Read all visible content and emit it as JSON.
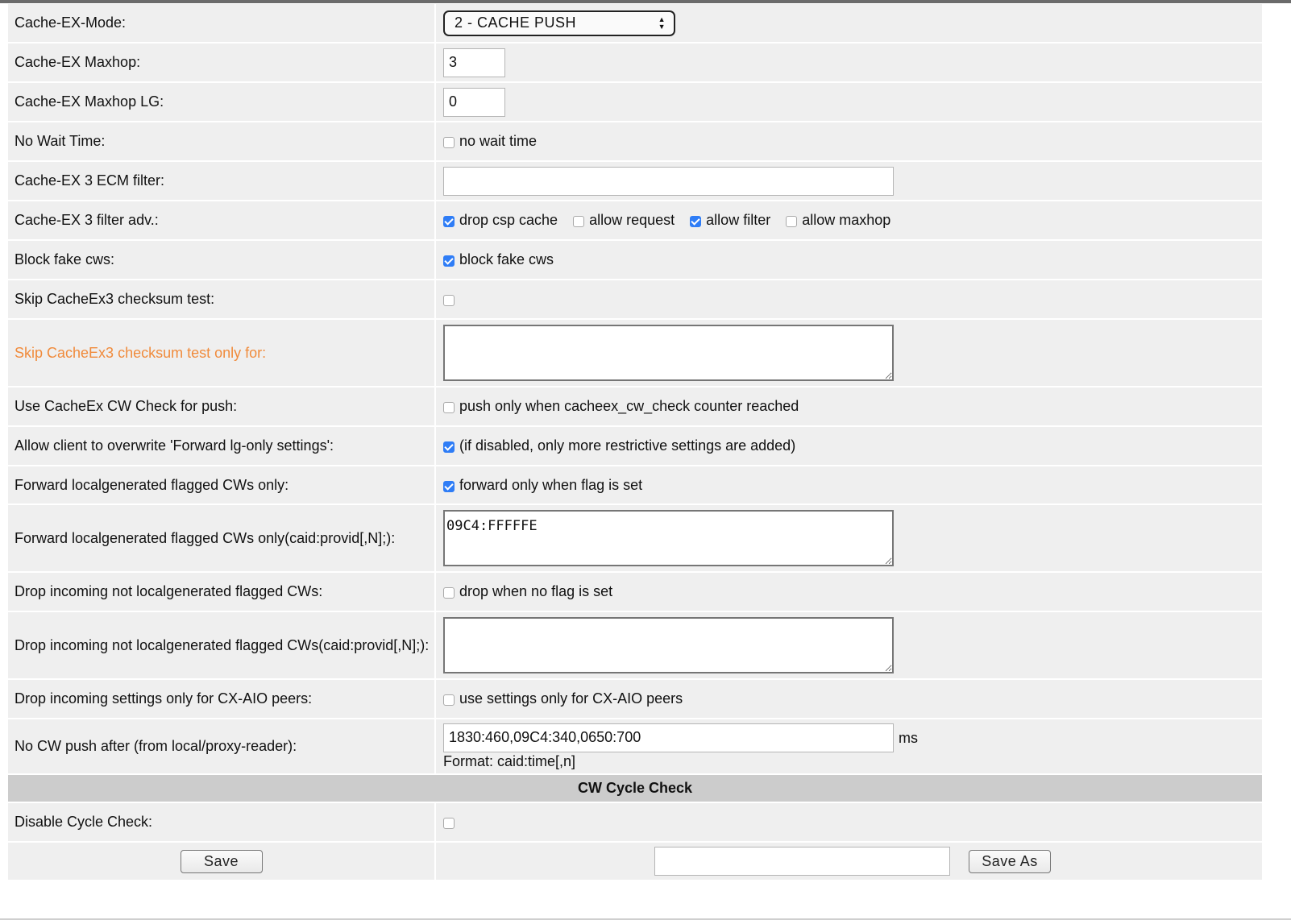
{
  "rows": {
    "cacheex_mode": {
      "label": "Cache-EX-Mode:",
      "value": "2 - CACHE PUSH"
    },
    "maxhop": {
      "label": "Cache-EX Maxhop:",
      "value": "3"
    },
    "maxhop_lg": {
      "label": "Cache-EX Maxhop LG:",
      "value": "0"
    },
    "no_wait": {
      "label": "No Wait Time:",
      "checkbox_label": "no wait time",
      "checked": false
    },
    "ecm_filter": {
      "label": "Cache-EX 3 ECM filter:",
      "value": ""
    },
    "filter_adv": {
      "label": "Cache-EX 3 filter adv.:",
      "options": [
        {
          "label": "drop csp cache",
          "checked": true
        },
        {
          "label": "allow request",
          "checked": false
        },
        {
          "label": "allow filter",
          "checked": true
        },
        {
          "label": "allow maxhop",
          "checked": false
        }
      ]
    },
    "block_fake": {
      "label": "Block fake cws:",
      "checkbox_label": "block fake cws",
      "checked": true
    },
    "skip_checksum": {
      "label": "Skip CacheEx3 checksum test:",
      "checked": false
    },
    "skip_checksum_only": {
      "label": "Skip CacheEx3 checksum test only for:",
      "value": ""
    },
    "cw_check_push": {
      "label": "Use CacheEx CW Check for push:",
      "checkbox_label": "push only when cacheex_cw_check counter reached",
      "checked": false
    },
    "allow_overwrite": {
      "label": "Allow client to overwrite 'Forward lg-only settings':",
      "checkbox_label": "(if disabled, only more restrictive settings are added)",
      "checked": true
    },
    "forward_lg_only": {
      "label": "Forward localgenerated flagged CWs only:",
      "checkbox_label": "forward only when flag is set",
      "checked": true
    },
    "forward_lg_caid": {
      "label": "Forward localgenerated flagged CWs only(caid:provid[,N];):",
      "value": "09C4:FFFFFE"
    },
    "drop_not_lg": {
      "label": "Drop incoming not localgenerated flagged CWs:",
      "checkbox_label": "drop when no flag is set",
      "checked": false
    },
    "drop_not_lg_caid": {
      "label": "Drop incoming not localgenerated flagged CWs(caid:provid[,N];):",
      "value": ""
    },
    "drop_cxaio": {
      "label": "Drop incoming settings only for CX-AIO peers:",
      "checkbox_label": "use settings only for CX-AIO peers",
      "checked": false
    },
    "no_push_after": {
      "label": "No CW push after (from local/proxy-reader):",
      "value": "1830:460,09C4:340,0650:700",
      "unit": "ms",
      "format": "Format: caid:time[,n]"
    }
  },
  "section_cycle": {
    "title": "CW Cycle Check"
  },
  "disable_cycle": {
    "label": "Disable Cycle Check:",
    "checked": false
  },
  "footer": {
    "save_label": "Save",
    "saveas_value": "",
    "saveas_label": "Save As"
  },
  "colors": {
    "row_bg": "#efefef",
    "section_bg": "#cccccc",
    "warning_label": "#f08b3c",
    "checkbox_accent": "#2f7df6"
  }
}
